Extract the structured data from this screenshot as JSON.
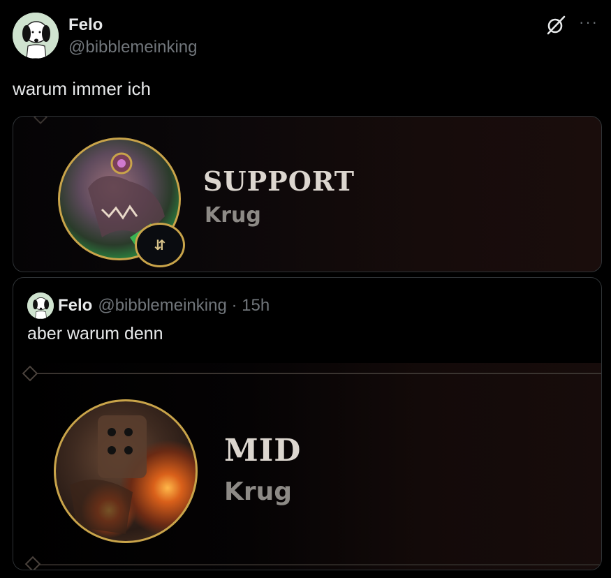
{
  "tweet": {
    "author_name": "Felo",
    "author_handle": "@bibblemeinking",
    "text": "warum immer ich",
    "icons": {
      "grok": "grok-icon",
      "more": "more-icon",
      "more_glyph": "···"
    }
  },
  "media": {
    "role": "SUPPORT",
    "champion": "Krug",
    "badge_glyph": "⇵"
  },
  "quoted_tweet": {
    "author_name": "Felo",
    "author_handle": "@bibblemeinking · 15h",
    "text": "aber warum denn",
    "media": {
      "role": "MID",
      "champion": "Krug"
    }
  },
  "colors": {
    "background": "#000000",
    "text_primary": "#e7e9ea",
    "text_secondary": "#71767b",
    "border": "#2f3336",
    "gold_ring": "#c9a44a"
  }
}
